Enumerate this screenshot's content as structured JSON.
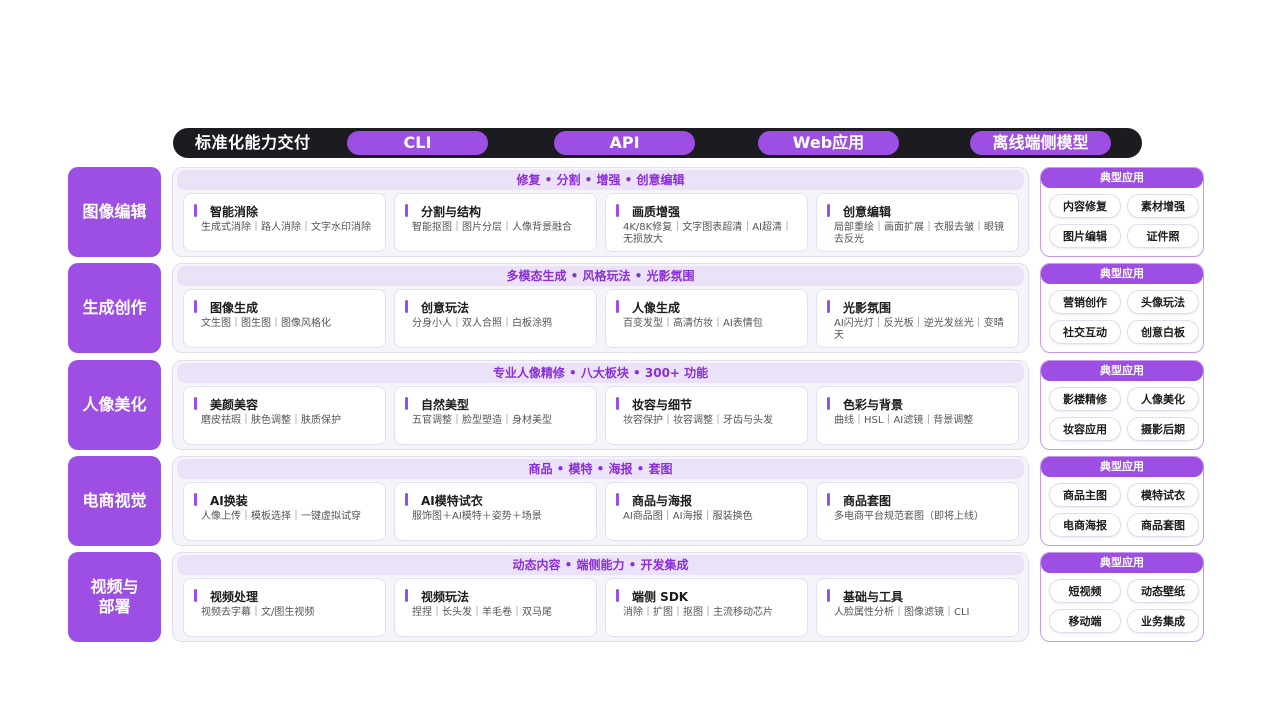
{
  "header": {
    "title": "标准化能力交付",
    "pills": [
      "CLI",
      "API",
      "Web应用",
      "离线端侧模型"
    ]
  },
  "rows": [
    {
      "category": "图像编辑",
      "headline": "修复 • 分割 • 增强 • 创意编辑",
      "cards": [
        {
          "title": "智能消除",
          "desc": "生成式消除｜路人消除｜文字水印消除"
        },
        {
          "title": "分割与结构",
          "desc": "智能抠图｜图片分层｜人像背景融合"
        },
        {
          "title": "画质增强",
          "desc": "4K/8K修复｜文字图表超清｜AI超清｜无损放大"
        },
        {
          "title": "创意编辑",
          "desc": "局部重绘｜画面扩展｜衣服去皱｜眼镜去反光"
        }
      ],
      "apps_title": "典型应用",
      "apps": [
        "内容修复",
        "素材增强",
        "图片编辑",
        "证件照"
      ]
    },
    {
      "category": "生成创作",
      "headline": "多模态生成 • 风格玩法 • 光影氛围",
      "cards": [
        {
          "title": "图像生成",
          "desc": "文生图｜图生图｜图像风格化"
        },
        {
          "title": "创意玩法",
          "desc": "分身小人｜双人合照｜白板涂鸦"
        },
        {
          "title": "人像生成",
          "desc": "百变发型｜高清仿妆｜AI表情包"
        },
        {
          "title": "光影氛围",
          "desc": "AI闪光灯｜反光板｜逆光发丝光｜变晴天"
        }
      ],
      "apps_title": "典型应用",
      "apps": [
        "营销创作",
        "头像玩法",
        "社交互动",
        "创意白板"
      ]
    },
    {
      "category": "人像美化",
      "headline": "专业人像精修 • 八大板块 • 300+ 功能",
      "cards": [
        {
          "title": "美颜美容",
          "desc": "磨皮祛瑕｜肤色调整｜肤质保护"
        },
        {
          "title": "自然美型",
          "desc": "五官调整｜脸型塑造｜身材美型"
        },
        {
          "title": "妆容与细节",
          "desc": "妆容保护｜妆容调整｜牙齿与头发"
        },
        {
          "title": "色彩与背景",
          "desc": "曲线｜HSL｜AI滤镜｜背景调整"
        }
      ],
      "apps_title": "典型应用",
      "apps": [
        "影楼精修",
        "人像美化",
        "妆容应用",
        "摄影后期"
      ]
    },
    {
      "category": "电商视觉",
      "headline": "商品 • 模特 • 海报 • 套图",
      "cards": [
        {
          "title": "AI换装",
          "desc": "人像上传｜模板选择｜一键虚拟试穿"
        },
        {
          "title": "AI模特试衣",
          "desc": "服饰图＋AI模特＋姿势＋场景"
        },
        {
          "title": "商品与海报",
          "desc": "AI商品图｜AI海报｜服装换色"
        },
        {
          "title": "商品套图",
          "desc": "多电商平台规范套图（即将上线）"
        }
      ],
      "apps_title": "典型应用",
      "apps": [
        "商品主图",
        "模特试衣",
        "电商海报",
        "商品套图"
      ]
    },
    {
      "category": "视频与\n部署",
      "headline": "动态内容 • 端侧能力 • 开发集成",
      "cards": [
        {
          "title": "视频处理",
          "desc": "视频去字幕｜文/图生视频"
        },
        {
          "title": "视频玩法",
          "desc": "捏捏｜长头发｜羊毛卷｜双马尾"
        },
        {
          "title": "端侧 SDK",
          "desc": "消除｜扩图｜抠图｜主流移动芯片"
        },
        {
          "title": "基础与工具",
          "desc": "人脸属性分析｜图像滤镜｜CLI"
        }
      ],
      "apps_title": "典型应用",
      "apps": [
        "短视频",
        "动态壁纸",
        "移动端",
        "业务集成"
      ]
    }
  ]
}
